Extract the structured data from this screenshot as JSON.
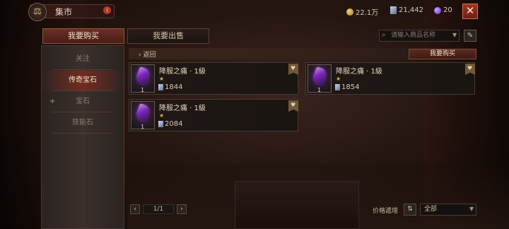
{
  "header": {
    "title": "集市",
    "info_badge": "i"
  },
  "currency": {
    "gold": "22.1万",
    "platinum": "21,442",
    "orbs": "20"
  },
  "close": "✕",
  "tabs": [
    {
      "label": "我要购买"
    },
    {
      "label": "我要出售"
    }
  ],
  "search": {
    "placeholder": "请输入商品名称"
  },
  "sidebar": {
    "items": [
      {
        "label": "关注"
      },
      {
        "label": "传奇宝石"
      },
      {
        "label": "宝石",
        "expandable": true,
        "expand_glyph": "+"
      },
      {
        "label": "技能石"
      }
    ]
  },
  "back": {
    "label": "返回",
    "glyph": "‹"
  },
  "want_buy_label": "我要购买",
  "items": [
    {
      "name": "降服之痛 · 1級",
      "qty": "1",
      "stars": "★",
      "price": "1844"
    },
    {
      "name": "降服之痛 · 1級",
      "qty": "1",
      "stars": "★",
      "price": "1854"
    },
    {
      "name": "降服之痛 · 1級",
      "qty": "1",
      "stars": "★",
      "price": "2084"
    }
  ],
  "pagination": {
    "page": "1/1",
    "prev": "‹",
    "next": "›"
  },
  "sort": {
    "label": "价格遞增",
    "direction_glyph": "⇅"
  },
  "filter": {
    "value": "全部"
  },
  "colors": {
    "accent_red": "#6a2e24",
    "close_red": "#a4341f",
    "gem_purple": "#7a28b8"
  }
}
